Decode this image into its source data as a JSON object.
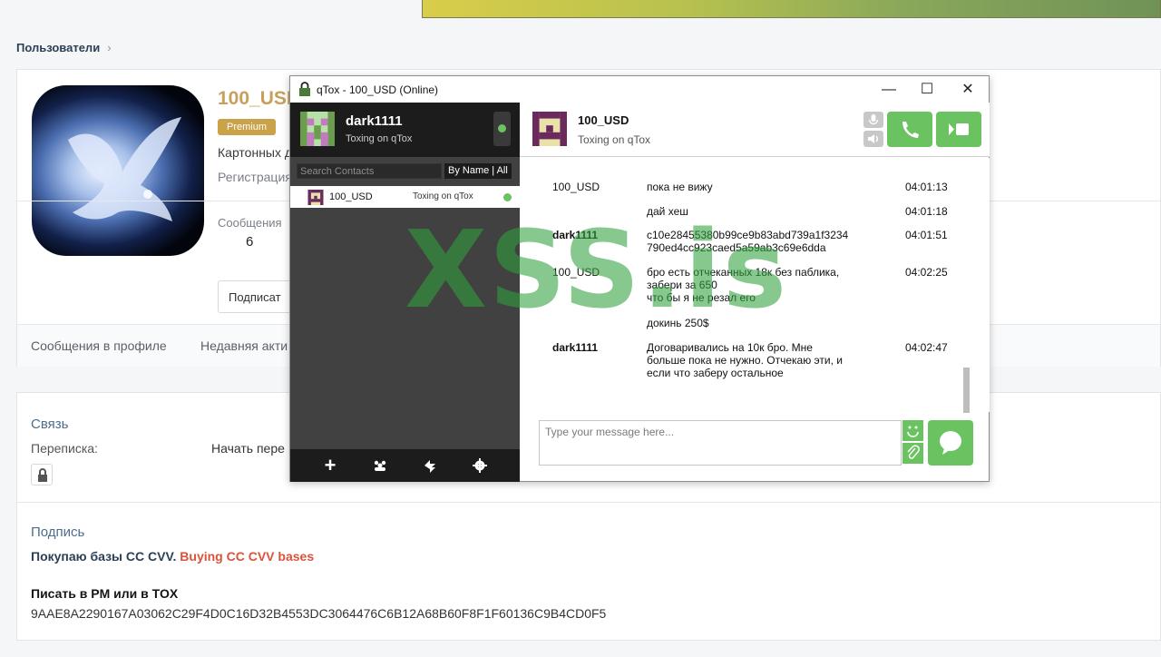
{
  "breadcrumb": {
    "label": "Пользователи",
    "chevron": "›"
  },
  "profile": {
    "username": "100_USD",
    "badge": "Premium",
    "user_title": "Картонных д",
    "registration": "Регистрация",
    "messages_label": "Сообщения",
    "messages_count": "6",
    "subscribe_label": "Подписат",
    "tabs": [
      "Сообщения в профиле",
      "Недавняя акти"
    ]
  },
  "contact_section": {
    "title": "Связь",
    "conversation_label": "Переписка:",
    "start_conversation": "Начать пере"
  },
  "signature": {
    "title": "Подпись",
    "line1_ru": "Покупаю базы CC CVV.",
    "line1_en": "Buying CC CVV bases",
    "line2": "Писать в PM или в TOX",
    "tox_id": "9AAE8A2290167A03062C29F4D0C16D32B4553DC3064476C6B12A68B60F8F1F60136C9B4CD0F5"
  },
  "qtox": {
    "window_title": "qTox - 100_USD (Online)",
    "controls": {
      "minimize": "—",
      "maximize": "☐",
      "close": "✕"
    },
    "self": {
      "name": "dark1111",
      "status": "Toxing on qTox"
    },
    "search_placeholder": "Search Contacts",
    "sort_label": "By Name | All",
    "contacts": [
      {
        "name": "100_USD",
        "status": "Toxing on qTox"
      }
    ],
    "peer": {
      "name": "100_USD",
      "status": "Toxing on qTox"
    },
    "messages": [
      {
        "author": "100_USD",
        "text": "пока не вижу",
        "time": "04:01:13"
      },
      {
        "author": "",
        "text": "дай хеш",
        "time": "04:01:18"
      },
      {
        "author": "dark1111",
        "text": "c10e28455380b99ce9b83abd739a1f3234\n790ed4cc923caed5a59ab3c69e6dda",
        "time": "04:01:51"
      },
      {
        "author": "100_USD",
        "text": "бро есть отчеканных 18к без паблика,\nзабери за 650\nчто бы я не резал его",
        "time": "04:02:25"
      },
      {
        "author": "",
        "text": "докинь 250$",
        "time": ""
      },
      {
        "author": "dark1111",
        "text": "Договаривались на 10к бро. Мне\nбольше пока не нужно. Отчекаю эти, и\nесли что заберу остальное",
        "time": "04:02:47"
      }
    ],
    "input_placeholder": "Type your message here...",
    "accent": "#6bc260"
  },
  "watermark": "XSS.is"
}
